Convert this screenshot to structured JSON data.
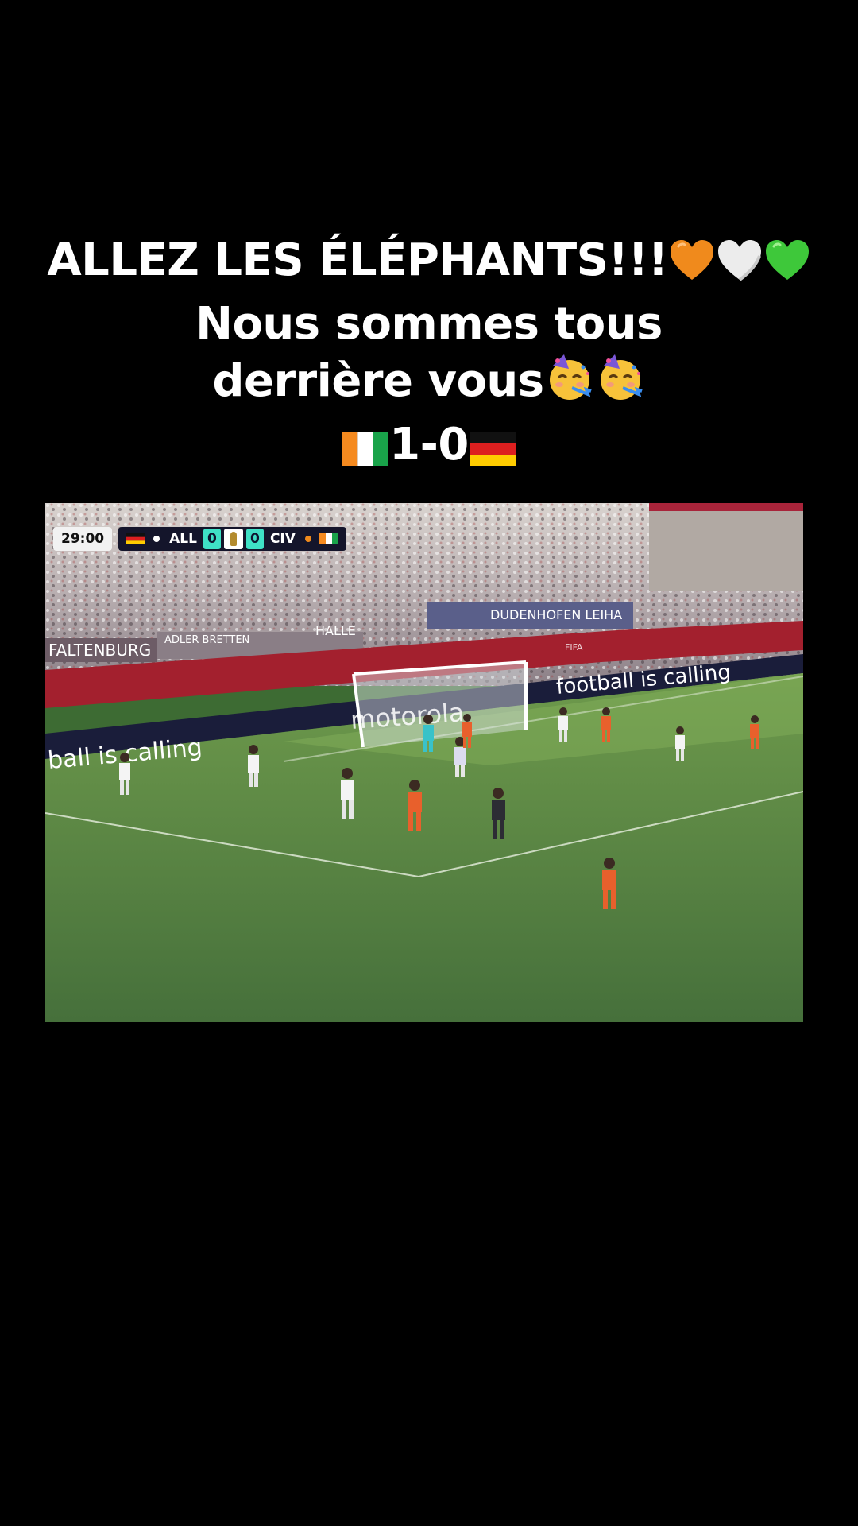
{
  "caption": {
    "line1": "ALLEZ LES ÉLÉPHANTS!!!",
    "line2": "Nous sommes tous",
    "line3": "derrière vous",
    "line4": "1-0"
  },
  "emojis": {
    "line1": [
      "orange-heart",
      "white-heart",
      "green-heart"
    ],
    "line3": [
      "partying-face",
      "partying-face"
    ],
    "line4_before": "ivory-coast-flag",
    "line4_after": "germany-flag"
  },
  "scorebug": {
    "clock": "29:00",
    "home_team": "ALL",
    "home_score": "0",
    "away_score": "0",
    "away_team": "CIV"
  },
  "stadium_text": {
    "board_left": "ball is calling",
    "board_right": "football is calling",
    "goal_sponsor": "motorola",
    "banner_1": "FALTENBURG",
    "banner_2": "ADLER BRETTEN",
    "banner_3": "HALLE",
    "banner_4": "DUDENHOFEN LEIHA",
    "fifa": "FIFA"
  },
  "colors": {
    "background": "#000000",
    "caption_text": "#ffffff",
    "pitch": "#4a7a3c",
    "scorebug_accent": "#3fe1c6"
  }
}
